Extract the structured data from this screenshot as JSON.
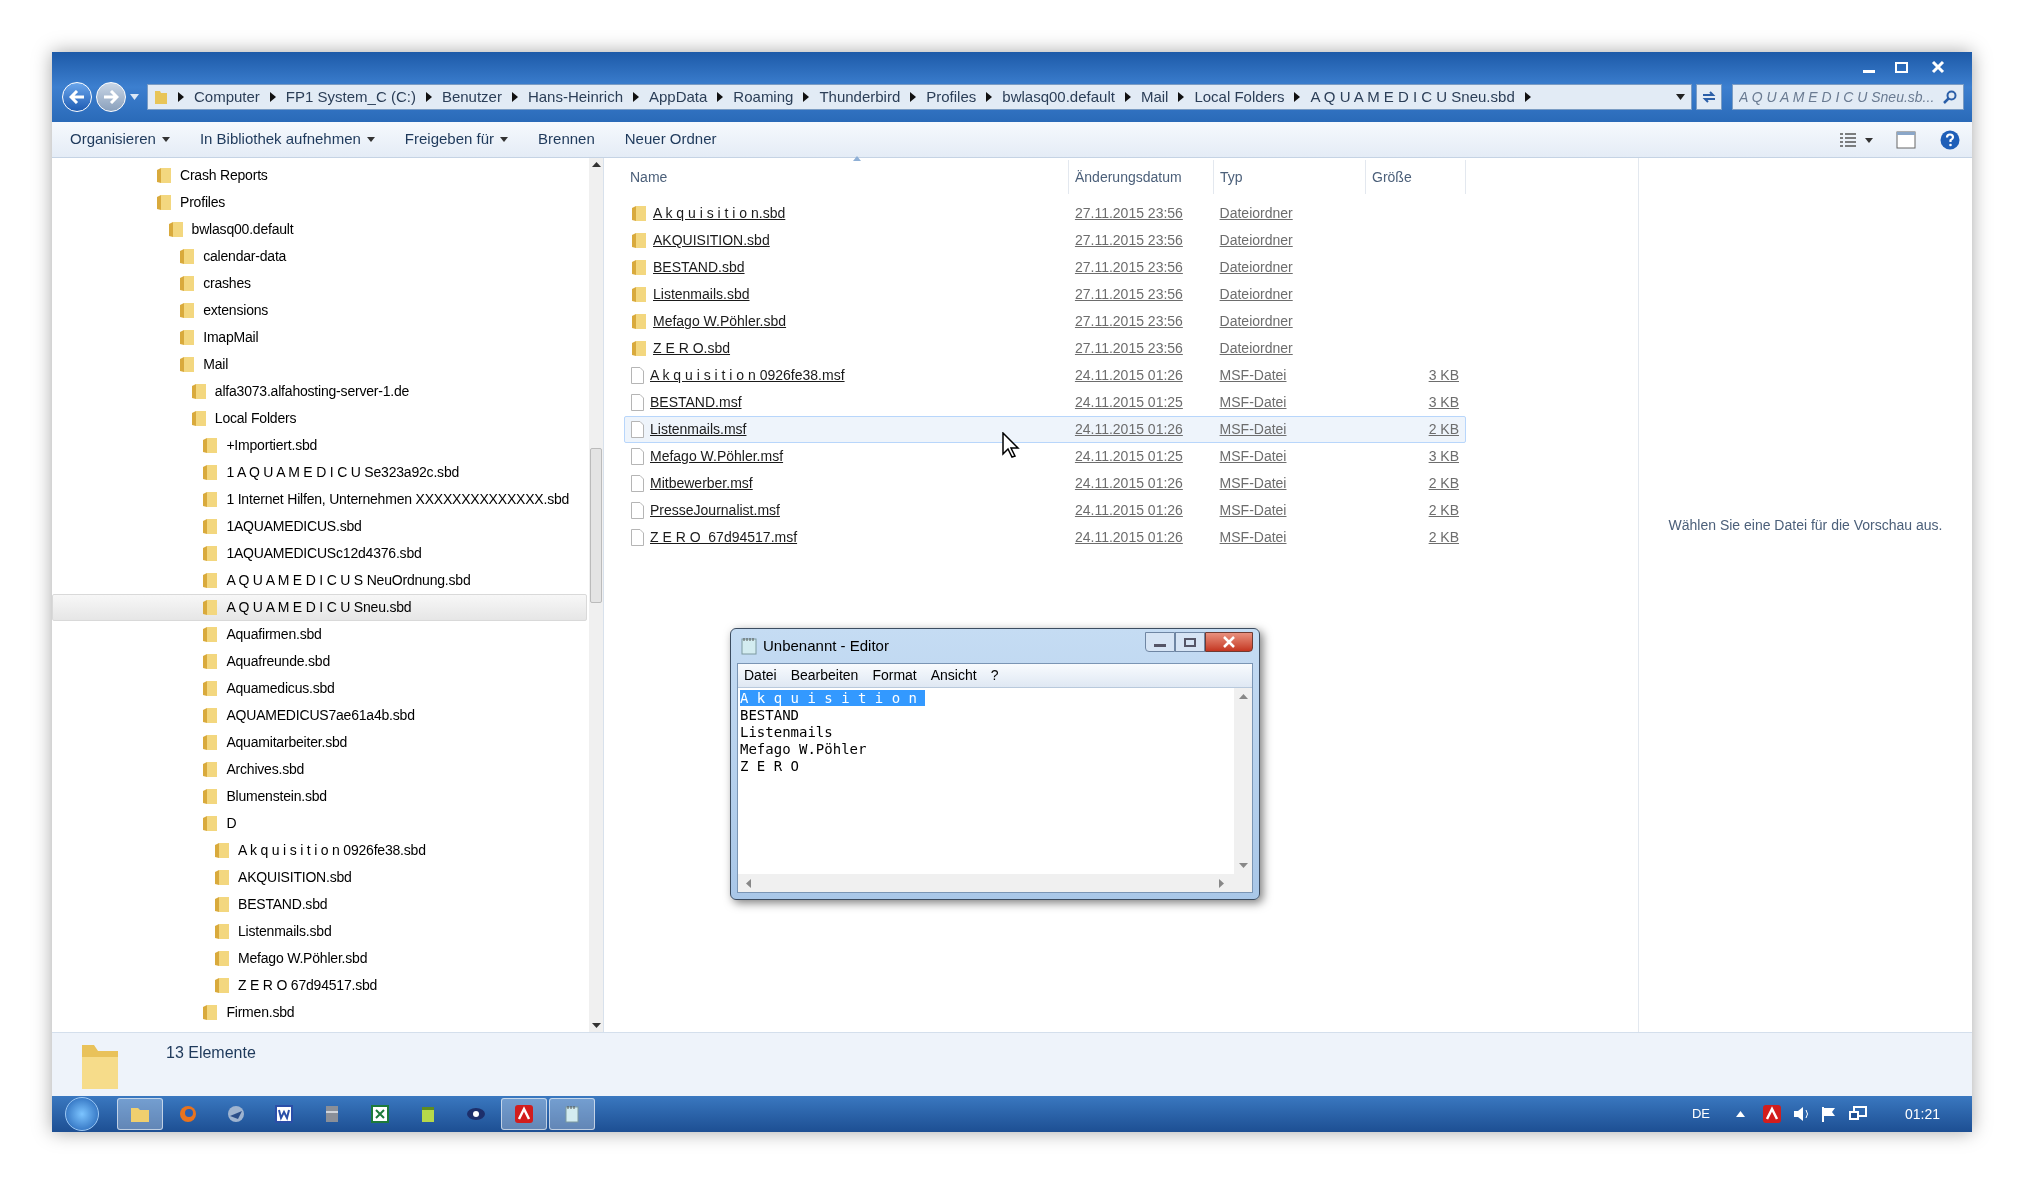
{
  "address_bar": {
    "breadcrumbs": [
      "Computer",
      "FP1 System_C (C:)",
      "Benutzer",
      "Hans-Heinrich",
      "AppData",
      "Roaming",
      "Thunderbird",
      "Profiles",
      "bwlasq00.default",
      "Mail",
      "Local Folders",
      "A Q U A M E D I C U Sneu.sbd"
    ]
  },
  "search": {
    "placeholder": "A Q U A M E D I C U Sneu.sb..."
  },
  "toolbar": [
    {
      "label": "Organisieren",
      "dropdown": true
    },
    {
      "label": "In Bibliothek aufnehmen",
      "dropdown": true
    },
    {
      "label": "Freigeben für",
      "dropdown": true
    },
    {
      "label": "Brennen",
      "dropdown": false
    },
    {
      "label": "Neuer Ordner",
      "dropdown": false
    }
  ],
  "tree": [
    {
      "label": "Crash Reports",
      "selected": false
    },
    {
      "label": "Profiles",
      "selected": false,
      "children": [
        {
          "label": "bwlasq00.default",
          "selected": false,
          "children": [
            {
              "label": "calendar-data",
              "selected": false
            },
            {
              "label": "crashes",
              "selected": false
            },
            {
              "label": "extensions",
              "selected": false
            },
            {
              "label": "ImapMail",
              "selected": false
            },
            {
              "label": "Mail",
              "selected": false,
              "children": [
                {
                  "label": "alfa3073.alfahosting-server-1.de",
                  "selected": false
                },
                {
                  "label": "Local Folders",
                  "selected": false,
                  "children": [
                    {
                      "label": "+Importiert.sbd",
                      "selected": false
                    },
                    {
                      "label": "1 A Q U A M E D I C U Se323a92c.sbd",
                      "selected": false
                    },
                    {
                      "label": "1 Internet Hilfen, Unternehmen XXXXXXXXXXXXXX.sbd",
                      "selected": false
                    },
                    {
                      "label": "1AQUAMEDICUS.sbd",
                      "selected": false
                    },
                    {
                      "label": "1AQUAMEDICUSc12d4376.sbd",
                      "selected": false
                    },
                    {
                      "label": "A Q U A M E D I C U S NeuOrdnung.sbd",
                      "selected": false
                    },
                    {
                      "label": "A Q U A M E D I C U Sneu.sbd",
                      "selected": true
                    },
                    {
                      "label": "Aquafirmen.sbd",
                      "selected": false
                    },
                    {
                      "label": "Aquafreunde.sbd",
                      "selected": false
                    },
                    {
                      "label": "Aquamedicus.sbd",
                      "selected": false
                    },
                    {
                      "label": "AQUAMEDICUS7ae61a4b.sbd",
                      "selected": false
                    },
                    {
                      "label": "Aquamitarbeiter.sbd",
                      "selected": false
                    },
                    {
                      "label": "Archives.sbd",
                      "selected": false
                    },
                    {
                      "label": "Blumenstein.sbd",
                      "selected": false
                    },
                    {
                      "label": "D",
                      "selected": false,
                      "children": [
                        {
                          "label": "A k q u i s i t i o n 0926fe38.sbd",
                          "selected": false
                        },
                        {
                          "label": "AKQUISITION.sbd",
                          "selected": false
                        },
                        {
                          "label": "BESTAND.sbd",
                          "selected": false
                        },
                        {
                          "label": "Listenmails.sbd",
                          "selected": false
                        },
                        {
                          "label": "Mefago W.Pöhler.sbd",
                          "selected": false
                        },
                        {
                          "label": "Z E R O  67d94517.sbd",
                          "selected": false
                        }
                      ]
                    },
                    {
                      "label": "Firmen.sbd",
                      "selected": false
                    }
                  ]
                }
              ]
            }
          ]
        }
      ]
    }
  ],
  "table": {
    "columns": [
      "Name",
      "Änderungsdatum",
      "Typ",
      "Größe"
    ],
    "rows": [
      {
        "kind": "folder",
        "name": "A k q u i s i t i o n.sbd",
        "date": "27.11.2015 23:56",
        "type": "Dateiordner",
        "highlighted": false
      },
      {
        "kind": "folder",
        "name": "AKQUISITION.sbd",
        "date": "27.11.2015 23:56",
        "type": "Dateiordner",
        "highlighted": false
      },
      {
        "kind": "folder",
        "name": "BESTAND.sbd",
        "date": "27.11.2015 23:56",
        "type": "Dateiordner",
        "highlighted": false
      },
      {
        "kind": "folder",
        "name": "Listenmails.sbd",
        "date": "27.11.2015 23:56",
        "type": "Dateiordner",
        "highlighted": false
      },
      {
        "kind": "folder",
        "name": "Mefago W.Pöhler.sbd",
        "date": "27.11.2015 23:56",
        "type": "Dateiordner",
        "highlighted": false
      },
      {
        "kind": "folder",
        "name": "Z E R O.sbd",
        "date": "27.11.2015 23:56",
        "type": "Dateiordner",
        "highlighted": false
      },
      {
        "kind": "file",
        "name": "A k q u i s i t i o n 0926fe38.msf",
        "date": "24.11.2015 01:26",
        "type": "MSF-Datei",
        "size": "3 KB",
        "highlighted": false
      },
      {
        "kind": "file",
        "name": "BESTAND.msf",
        "date": "24.11.2015 01:25",
        "type": "MSF-Datei",
        "size": "3 KB",
        "highlighted": false
      },
      {
        "kind": "file",
        "name": "Listenmails.msf",
        "date": "24.11.2015 01:26",
        "type": "MSF-Datei",
        "size": "2 KB",
        "highlighted": true
      },
      {
        "kind": "file",
        "name": "Mefago W.Pöhler.msf",
        "date": "24.11.2015 01:25",
        "type": "MSF-Datei",
        "size": "3 KB",
        "highlighted": false
      },
      {
        "kind": "file",
        "name": "Mitbewerber.msf",
        "date": "24.11.2015 01:26",
        "type": "MSF-Datei",
        "size": "2 KB",
        "highlighted": false
      },
      {
        "kind": "file",
        "name": "PresseJournalist.msf",
        "date": "24.11.2015 01:26",
        "type": "MSF-Datei",
        "size": "2 KB",
        "highlighted": false
      },
      {
        "kind": "file",
        "name": "Z E R O  67d94517.msf",
        "date": "24.11.2015 01:26",
        "type": "MSF-Datei",
        "size": "2 KB",
        "highlighted": false
      }
    ]
  },
  "preview": {
    "message": "Wählen Sie eine Datei für die Vorschau aus."
  },
  "status_bar": {
    "count": "13 Elemente"
  },
  "notepad": {
    "title": "Unbenannt - Editor",
    "menu": [
      "Datei",
      "Bearbeiten",
      "Format",
      "Ansicht",
      "?"
    ],
    "lines": [
      {
        "text": "A k q u i s i t i o n ",
        "selected": true
      },
      {
        "text": "BESTAND",
        "selected": false
      },
      {
        "text": "Listenmails",
        "selected": false
      },
      {
        "text": "Mefago W.Pöhler",
        "selected": false
      },
      {
        "text": "Z E R O",
        "selected": false
      }
    ]
  },
  "taskbar": {
    "apps": [
      {
        "kind": "explorer",
        "active": true
      },
      {
        "kind": "firefox",
        "active": false
      },
      {
        "kind": "thunderbird",
        "active": false
      },
      {
        "kind": "word",
        "active": false
      },
      {
        "kind": "archive",
        "active": false
      },
      {
        "kind": "excel",
        "active": false
      },
      {
        "kind": "notes",
        "active": false
      },
      {
        "kind": "eye",
        "active": false
      },
      {
        "kind": "avira",
        "active": true
      },
      {
        "kind": "notepad",
        "active": true
      }
    ],
    "language": "DE",
    "time": "01:21"
  }
}
